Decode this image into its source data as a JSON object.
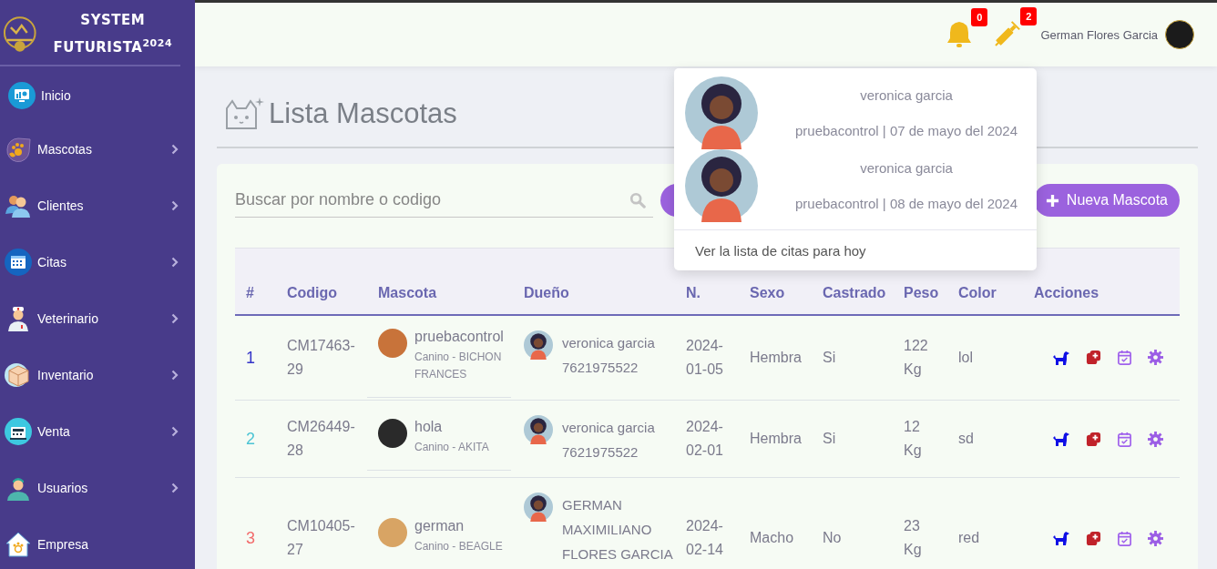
{
  "brand": {
    "title": "SYSTEM FUTURISTA$^{2024}$"
  },
  "sidebar": {
    "items": [
      {
        "label": "Inicio",
        "kind": "monitor",
        "expandable": false
      },
      {
        "label": "Mascotas",
        "kind": "paw",
        "expandable": true
      },
      {
        "label": "Clientes",
        "kind": "people",
        "expandable": true
      },
      {
        "label": "Citas",
        "kind": "calendar",
        "expandable": true
      },
      {
        "label": "Veterinario",
        "kind": "doctor",
        "expandable": true
      },
      {
        "label": "Inventario",
        "kind": "box",
        "expandable": true
      },
      {
        "label": "Venta",
        "kind": "register",
        "expandable": true
      },
      {
        "label": "Usuarios",
        "kind": "user",
        "expandable": true
      },
      {
        "label": "Empresa",
        "kind": "house",
        "expandable": false
      }
    ]
  },
  "topbar": {
    "notifications": [
      {
        "kind": "bell",
        "count": "0"
      },
      {
        "kind": "syringe",
        "count": "2"
      }
    ],
    "user_name": "German Flores Garcia"
  },
  "page": {
    "title": "Lista Mascotas"
  },
  "search": {
    "placeholder": "Buscar por nombre o codigo"
  },
  "new_button": {
    "label": "Nueva Mascota"
  },
  "table": {
    "columns": [
      "#",
      "Codigo",
      "Mascota",
      "Dueño",
      "N.",
      "Sexo",
      "Castrado",
      "Peso",
      "Color",
      "Acciones"
    ],
    "rows": [
      {
        "number": "1",
        "color": "#3434c8",
        "code": "CM17463-29",
        "pet_name": "pruebacontrol",
        "pet_breed": "Canino - BICHON FRANCES",
        "owner": "veronica garcia 7621975522",
        "birth_date": "2024-01-05",
        "sex": "Hembra",
        "neutered": "Si",
        "weight": "122 Kg",
        "pet_color": "lol"
      },
      {
        "number": "2",
        "color": "#4cc4d4",
        "code": "CM26449-28",
        "pet_name": "hola",
        "pet_breed": "Canino - AKITA",
        "owner": "veronica garcia 7621975522",
        "birth_date": "2024-02-01",
        "sex": "Hembra",
        "neutered": "Si",
        "weight": "12 Kg",
        "pet_color": "sd"
      },
      {
        "number": "3",
        "color": "#f26b6b",
        "code": "CM10405-27",
        "pet_name": "german",
        "pet_breed": "Canino - BEAGLE",
        "owner": "GERMAN MAXIMILIANO FLORES GARCIA",
        "birth_date": "2024-02-14",
        "sex": "Macho",
        "neutered": "No",
        "weight": "23 Kg",
        "pet_color": "red"
      }
    ]
  },
  "notifications_dropdown": {
    "items": [
      {
        "name": "veronica garcia",
        "detail": "pruebacontrol | 07 de mayo del 2024"
      },
      {
        "name": "veronica garcia",
        "detail": "pruebacontrol | 08 de mayo del 2024"
      }
    ],
    "footer_link": "Ver la lista de citas para hoy"
  }
}
